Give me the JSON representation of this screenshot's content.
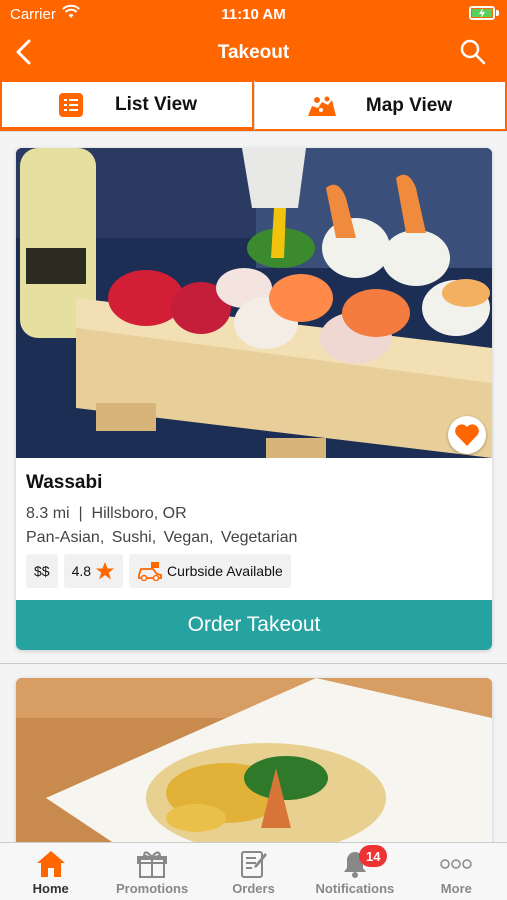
{
  "status_bar": {
    "carrier": "Carrier",
    "time": "11:10 AM"
  },
  "nav": {
    "title": "Takeout",
    "back_icon": "chevron-left-icon",
    "search_icon": "search-icon"
  },
  "tabs": [
    {
      "label": "List View",
      "icon": "list-icon",
      "active": true
    },
    {
      "label": "Map View",
      "icon": "map-icon",
      "active": false
    }
  ],
  "restaurants": [
    {
      "name": "Wassabi",
      "distance": "8.3 mi",
      "separator": "|",
      "location": "Hillsboro, OR",
      "cuisines": "Pan-Asian,  Sushi,  Vegan,  Vegetarian",
      "price": "$$",
      "rating": "4.8",
      "curbside": "Curbside Available",
      "favorite": true,
      "button": "Order Takeout"
    }
  ],
  "tabbar": [
    {
      "label": "Home",
      "icon": "home-icon",
      "active": true
    },
    {
      "label": "Promotions",
      "icon": "gift-icon",
      "active": false
    },
    {
      "label": "Orders",
      "icon": "orders-icon",
      "active": false
    },
    {
      "label": "Notifications",
      "icon": "bell-icon",
      "active": false,
      "badge": "14"
    },
    {
      "label": "More",
      "icon": "more-icon",
      "active": false
    }
  ],
  "colors": {
    "brand": "#ff6600",
    "button": "#26a3a0",
    "badge": "#ee3333"
  }
}
